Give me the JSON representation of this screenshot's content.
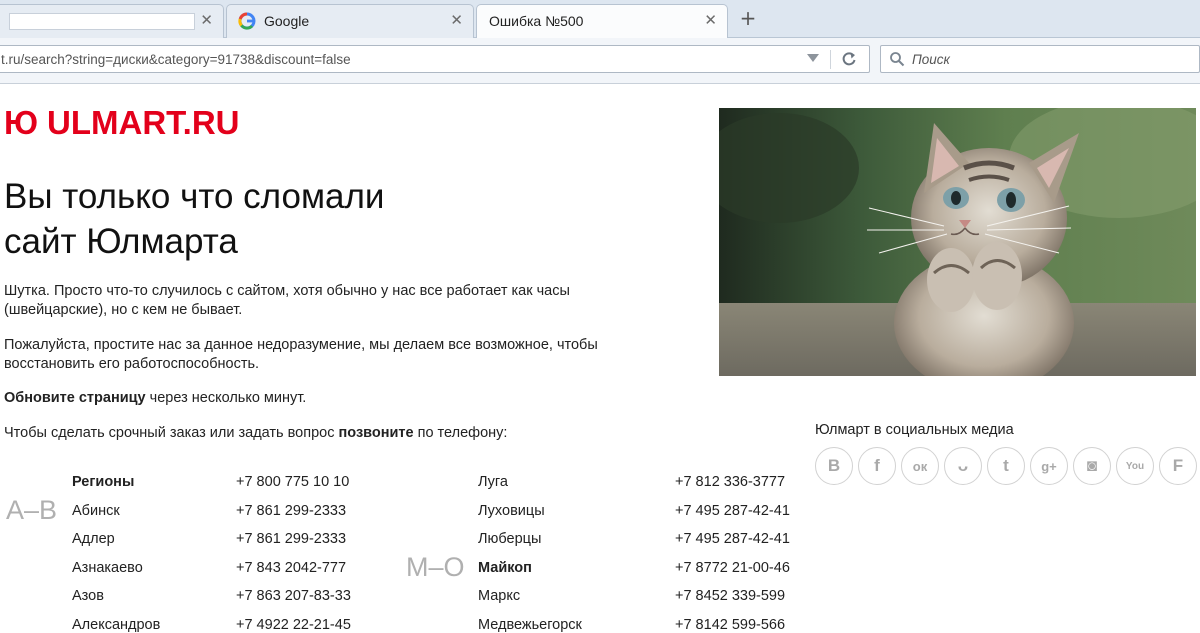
{
  "browser": {
    "tabs": [
      {
        "title": "",
        "close": "✕"
      },
      {
        "title": "Google",
        "close": "✕"
      },
      {
        "title": "Ошибка №500",
        "close": "✕"
      }
    ],
    "new_tab": "+",
    "url": "t.ru/search?string=диски&category=91738&discount=false",
    "search_placeholder": "Поиск"
  },
  "page": {
    "logo_mark": "Ю",
    "logo_text": "ULMART.RU",
    "headline_line1": "Вы только что сломали",
    "headline_line2": "сайт Юлмарта",
    "p1": "Шутка. Просто что-то случилось с сайтом, хотя обычно у нас все работает как часы (швейцарские), но с кем не бывает.",
    "p2": "Пожалуйста, простите нас за данное недоразумение, мы делаем все возможное, чтобы восстановить его работоспособность.",
    "p3_bold": "Обновите страницу",
    "p3_rest": " через несколько минут.",
    "p4_start": "Чтобы сделать срочный заказ или задать вопрос ",
    "p4_bold": "позвоните",
    "p4_end": " по телефону:"
  },
  "social": {
    "title": "Юлмарт в социальных медиа",
    "items": [
      {
        "icon": "vk-icon",
        "glyph": "B"
      },
      {
        "icon": "facebook-icon",
        "glyph": "f"
      },
      {
        "icon": "odnoklassniki-icon",
        "glyph": "ок"
      },
      {
        "icon": "moimir-icon",
        "glyph": "ᴗ"
      },
      {
        "icon": "twitter-icon",
        "glyph": "t"
      },
      {
        "icon": "googleplus-icon",
        "glyph": "g+"
      },
      {
        "icon": "instagram-icon",
        "glyph": "◙"
      },
      {
        "icon": "youtube-icon",
        "glyph": "You"
      },
      {
        "icon": "foursquare-icon",
        "glyph": "F"
      }
    ]
  },
  "phones": {
    "group1_letter": "А–В",
    "group2_letter": "М–О",
    "left": [
      {
        "city": "Регионы",
        "phone": "+7 800 775 10 10",
        "bold": true
      },
      {
        "city": "Абинск",
        "phone": "+7 861 299-2333",
        "bold": false
      },
      {
        "city": "Адлер",
        "phone": "+7 861 299-2333",
        "bold": false
      },
      {
        "city": "Азнакаево",
        "phone": "+7 843 2042-777",
        "bold": false
      },
      {
        "city": "Азов",
        "phone": "+7 863 207-83-33",
        "bold": false
      },
      {
        "city": "Александров",
        "phone": "+7 4922 22-21-45",
        "bold": false
      }
    ],
    "right": [
      {
        "city": "Луга",
        "phone": "+7 812 336-3777",
        "bold": false
      },
      {
        "city": "Луховицы",
        "phone": "+7 495 287-42-41",
        "bold": false
      },
      {
        "city": "Люберцы",
        "phone": "+7 495 287-42-41",
        "bold": false
      },
      {
        "city": "Майкоп",
        "phone": "+7 8772 21-00-46",
        "bold": true
      },
      {
        "city": "Маркс",
        "phone": "+7 8452 339-599",
        "bold": false
      },
      {
        "city": "Медвежьегорск",
        "phone": "+7 8142 599-566",
        "bold": false
      }
    ]
  },
  "colors": {
    "brand_red": "#e3001b",
    "letter_gray": "#b0b0b0",
    "social_gray": "#a9a9a9"
  }
}
